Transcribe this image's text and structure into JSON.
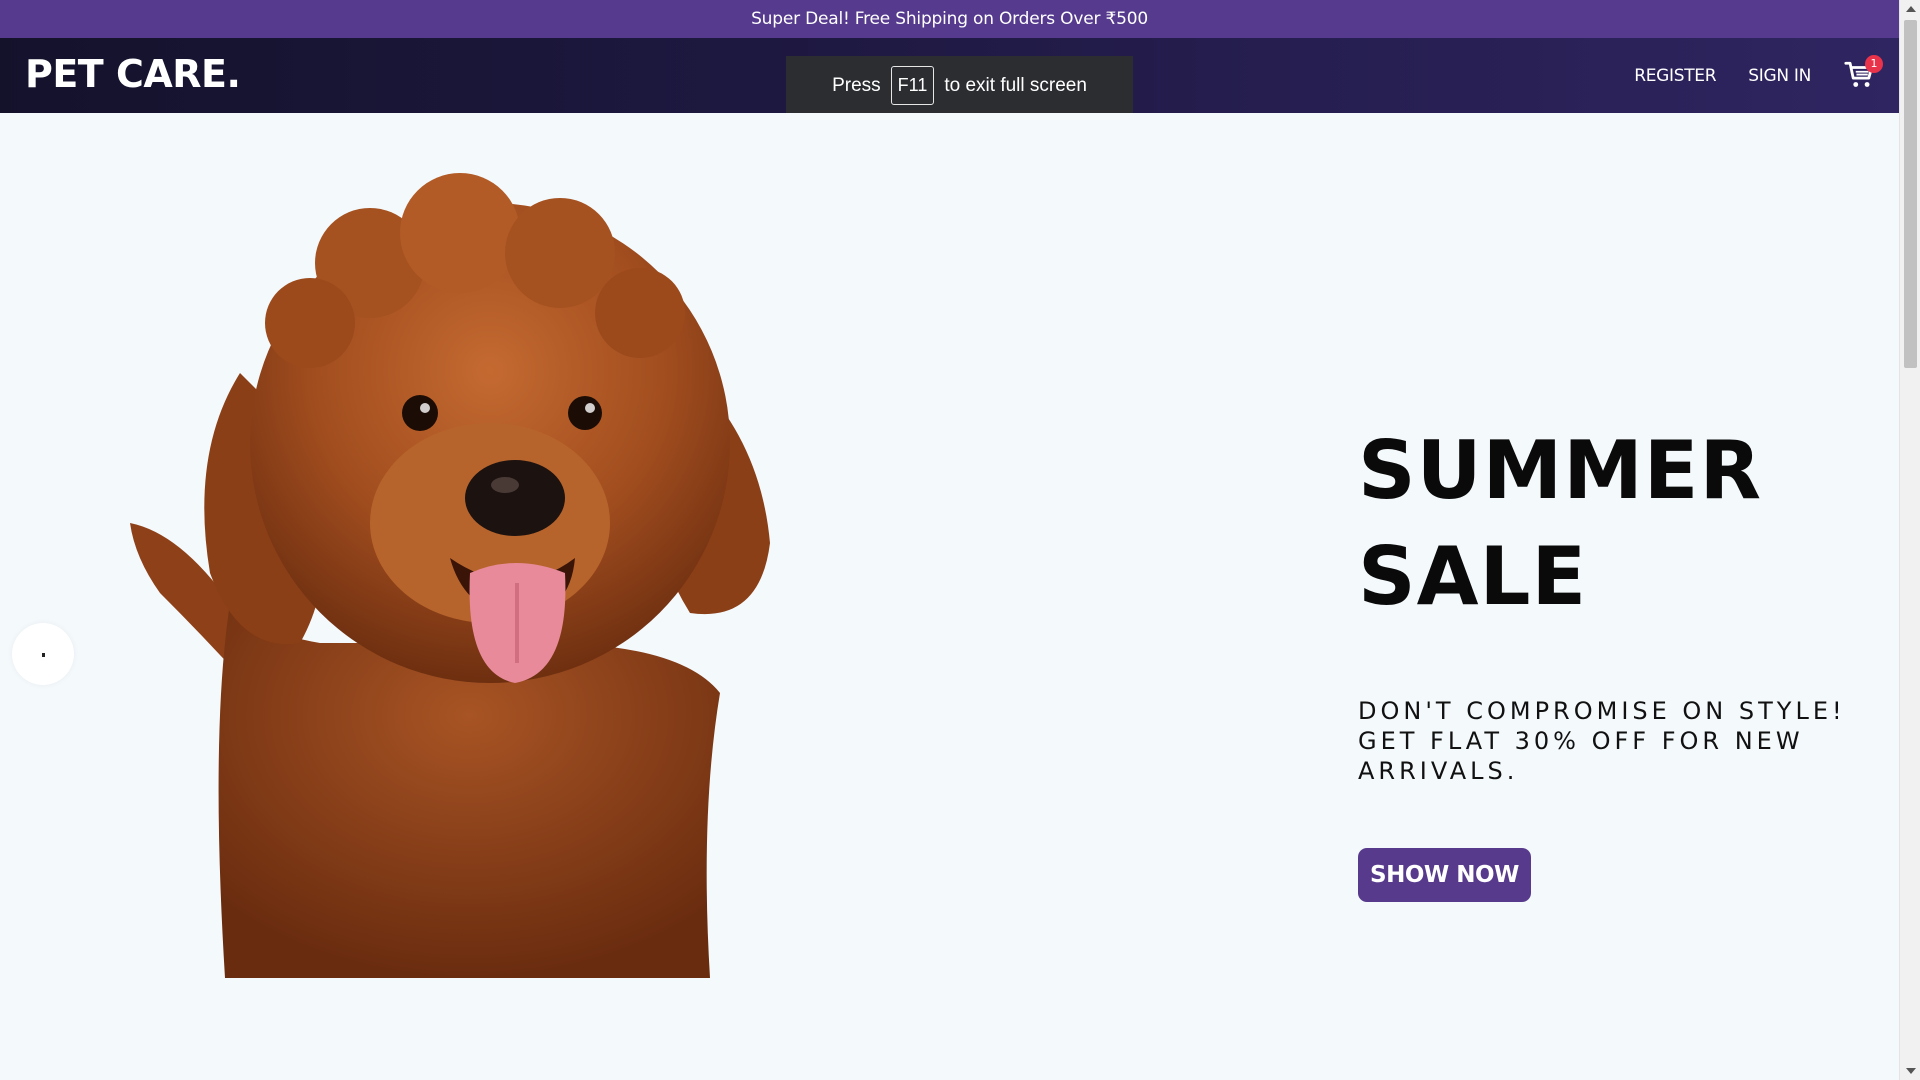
{
  "announcement": {
    "text": "Super Deal! Free Shipping on Orders Over ₹500"
  },
  "navbar": {
    "logo": "PET CARE.",
    "links": [
      {
        "label": "REGISTER"
      },
      {
        "label": "SIGN IN"
      }
    ],
    "cart": {
      "icon": "cart-icon",
      "badge_count": "1"
    }
  },
  "fullscreen_toast": {
    "prefix": "Press",
    "key": "F11",
    "suffix": "to exit full screen"
  },
  "hero": {
    "title_line1": "SUMMER",
    "title_line2": "SALE",
    "description": "DON'T COMPROMISE ON STYLE! GET FLAT 30% OFF FOR NEW ARRIVALS.",
    "cta_label": "SHOW NOW",
    "image": "dog-photo"
  },
  "colors": {
    "announcement_bg": "#553a8e",
    "navbar_bg": "#1d1840",
    "accent": "#573a8c",
    "badge": "#e8334a",
    "hero_bg": "#f4f9fc"
  }
}
